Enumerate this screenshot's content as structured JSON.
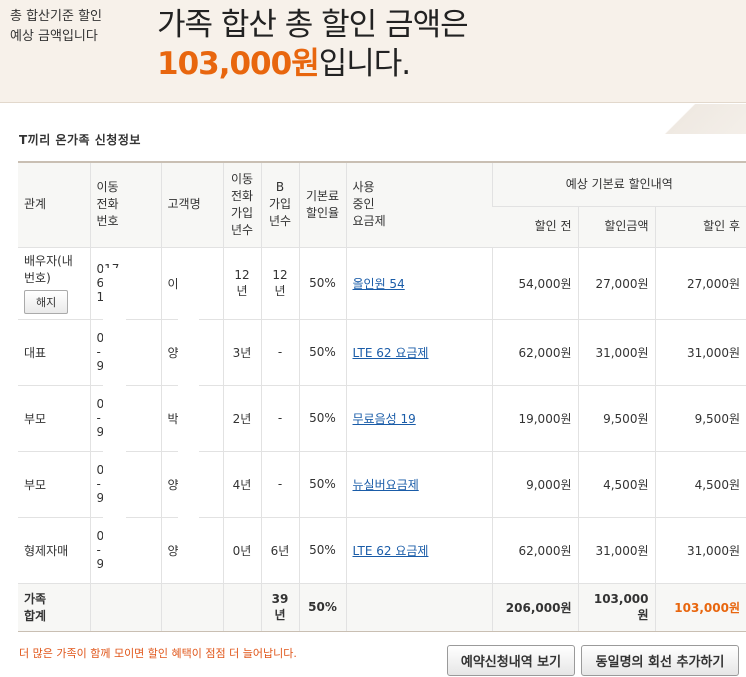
{
  "banner": {
    "left_line1": "총 합산기준 할인",
    "left_line2": "예상 금액입니다",
    "title_line1": "가족 합산 총 할인 금액은",
    "amount": "103,000원",
    "title_suffix": "입니다."
  },
  "section_title": "T끼리 온가족 신청정보",
  "table": {
    "headers": {
      "relation": "관계",
      "phone_l1": "이동",
      "phone_l2": "전화",
      "phone_l3": "번호",
      "name": "고객명",
      "mobile_years_l1": "이동",
      "mobile_years_l2": "전화",
      "mobile_years_l3": "가입",
      "mobile_years_l4": "년수",
      "b_years_l1": "B",
      "b_years_l2": "가입",
      "b_years_l3": "년수",
      "discount_rate_l1": "기본료",
      "discount_rate_l2": "할인율",
      "plan_l1": "사용",
      "plan_l2": "중인",
      "plan_l3": "요금제",
      "group": "예상 기본료 할인내역",
      "before": "할인 전",
      "discount": "할인금액",
      "after": "할인 후"
    },
    "rows": [
      {
        "relation_l1": "배우자(내",
        "relation_l2": "번호)",
        "action": "해지",
        "phone_l1": "017-",
        "phone_l2": "6",
        "phone_l3": "1",
        "name": "이",
        "mobile_years": "12년",
        "b_years": "12년",
        "rate": "50%",
        "plan": "올인원 54",
        "before": "54,000원",
        "discount": "27,000원",
        "after": "27,000원"
      },
      {
        "relation_l1": "대표",
        "phone_l1": "0",
        "phone_l2": "-",
        "phone_l3": "9",
        "name": "양",
        "mobile_years": "3년",
        "b_years": "-",
        "rate": "50%",
        "plan": "LTE 62 요금제",
        "before": "62,000원",
        "discount": "31,000원",
        "after": "31,000원"
      },
      {
        "relation_l1": "부모",
        "phone_l1": "0",
        "phone_l2": "-",
        "phone_l3": "9",
        "name": "박",
        "mobile_years": "2년",
        "b_years": "-",
        "rate": "50%",
        "plan": "무료음성 19",
        "before": "19,000원",
        "discount": "9,500원",
        "after": "9,500원"
      },
      {
        "relation_l1": "부모",
        "phone_l1": "0",
        "phone_l2": "-",
        "phone_l3": "9",
        "name": "양",
        "mobile_years": "4년",
        "b_years": "-",
        "rate": "50%",
        "plan": "뉴실버요금제",
        "before": "9,000원",
        "discount": "4,500원",
        "after": "4,500원"
      },
      {
        "relation_l1": "형제자매",
        "phone_l1": "0",
        "phone_l2": "-",
        "phone_l3": "9",
        "name": "양",
        "mobile_years": "0년",
        "b_years": "6년",
        "rate": "50%",
        "plan": "LTE 62 요금제",
        "before": "62,000원",
        "discount": "31,000원",
        "after": "31,000원"
      }
    ],
    "total": {
      "label_l1": "가족",
      "label_l2": "합계",
      "b_years": "39년",
      "rate": "50%",
      "before": "206,000원",
      "discount": "103,000원",
      "after": "103,000원"
    }
  },
  "footer": {
    "note": "더 많은 가족이 함께 모이면 할인 혜택이 점점 더 늘어납니다.",
    "btn_view": "예약신청내역 보기",
    "btn_add": "동일명의 회선 추가하기"
  },
  "colors": {
    "accent": "#e8660e",
    "link": "#1a5ca8",
    "banner_bg": "#f7f1ea"
  }
}
